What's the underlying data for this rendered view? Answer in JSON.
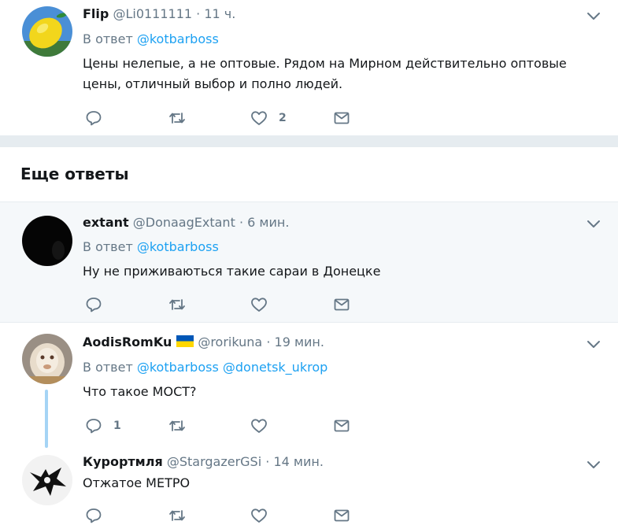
{
  "tweets": [
    {
      "name": "Flip",
      "handle": "@Li0111111",
      "dot": "·",
      "time": "11 ч.",
      "reply_prefix": "В ответ",
      "mentions": [
        "@kotbarboss"
      ],
      "text": "Цены нелепые, а не оптовые. Рядом на Мирном действительно оптовые цены, отличный выбор и полно людей.",
      "replies": "",
      "likes": "2"
    },
    {
      "name": "extant",
      "handle": "@DonaagExtant",
      "dot": "·",
      "time": "6 мин.",
      "reply_prefix": "В ответ",
      "mentions": [
        "@kotbarboss"
      ],
      "text": "Ну не приживаються такие сараи в Донецке",
      "replies": "",
      "likes": ""
    },
    {
      "name": "AodisRomKu",
      "handle": "@rorikuna",
      "dot": "·",
      "time": "19 мин.",
      "reply_prefix": "В ответ",
      "mentions": [
        "@kotbarboss",
        "@donetsk_ukrop"
      ],
      "text": "Что такое МОСТ?",
      "replies": "1",
      "likes": ""
    },
    {
      "name": "Курортмля",
      "handle": "@StargazerGSi",
      "dot": "·",
      "time": "14 мин.",
      "text": "Отжатое МЕТРО",
      "replies": "",
      "likes": ""
    }
  ],
  "section": {
    "title": "Еще ответы"
  },
  "icons": {
    "reply": "reply-icon",
    "retweet": "retweet-icon",
    "like": "heart-icon",
    "dm": "envelope-icon",
    "caret": "chevron-down-icon"
  },
  "colors": {
    "link": "#1da1f2",
    "muted": "#657786",
    "text": "#14171a",
    "divider": "#e6ecf0",
    "highlight_bg": "#f5f8fa",
    "thread_line": "#a5d4f5"
  }
}
